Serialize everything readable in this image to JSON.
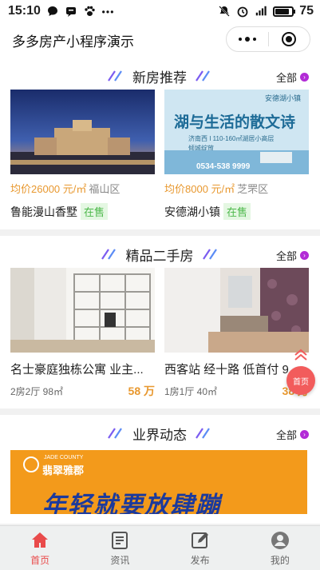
{
  "status_bar": {
    "time": "15:10",
    "battery": "75"
  },
  "nav": {
    "title": "多多房产小程序演示"
  },
  "sections": {
    "new_homes": {
      "title": "新房推荐",
      "more": "全部",
      "items": [
        {
          "price": "均价26000 元/㎡",
          "district": "福山区",
          "name": "鲁能漫山香墅",
          "tag": "在售"
        },
        {
          "price": "均价8000 元/㎡",
          "district": "芝罘区",
          "name": "安德湖小镇",
          "tag": "在售",
          "banner": {
            "headline": "湖与生活的散文诗",
            "sub": "济南西 I 110-160㎡湖居小高层",
            "sub2": "倾城绽放",
            "brand": "安德湖小镇",
            "phone": "0534-538 9999"
          }
        }
      ]
    },
    "second_hand": {
      "title": "精品二手房",
      "more": "全部",
      "items": [
        {
          "title": "名士豪庭独栋公寓 业主...",
          "layout": "2房2厅 98㎡",
          "total": "58 万"
        },
        {
          "title": "西客站 经十路 低首付 9...",
          "layout": "1房1厅 40㎡",
          "total": "38 万"
        }
      ]
    },
    "news": {
      "title": "业界动态",
      "more": "全部",
      "banner": {
        "brand": "翡翠雅郡",
        "brand_en": "JADE COUNTY",
        "slogan": "年轻就要放肆蹦"
      }
    }
  },
  "float_button": {
    "label": "首页"
  },
  "tabbar": {
    "items": [
      {
        "label": "首页",
        "icon": "home-icon",
        "active": true
      },
      {
        "label": "资讯",
        "icon": "news-icon"
      },
      {
        "label": "发布",
        "icon": "edit-icon"
      },
      {
        "label": "我的",
        "icon": "user-icon"
      }
    ]
  },
  "colors": {
    "accent": "#e94b4b",
    "price": "#e8982f",
    "tag_bg": "#e4f7e2",
    "tag_text": "#4cb84a",
    "more_dot": "#b22bd6"
  }
}
